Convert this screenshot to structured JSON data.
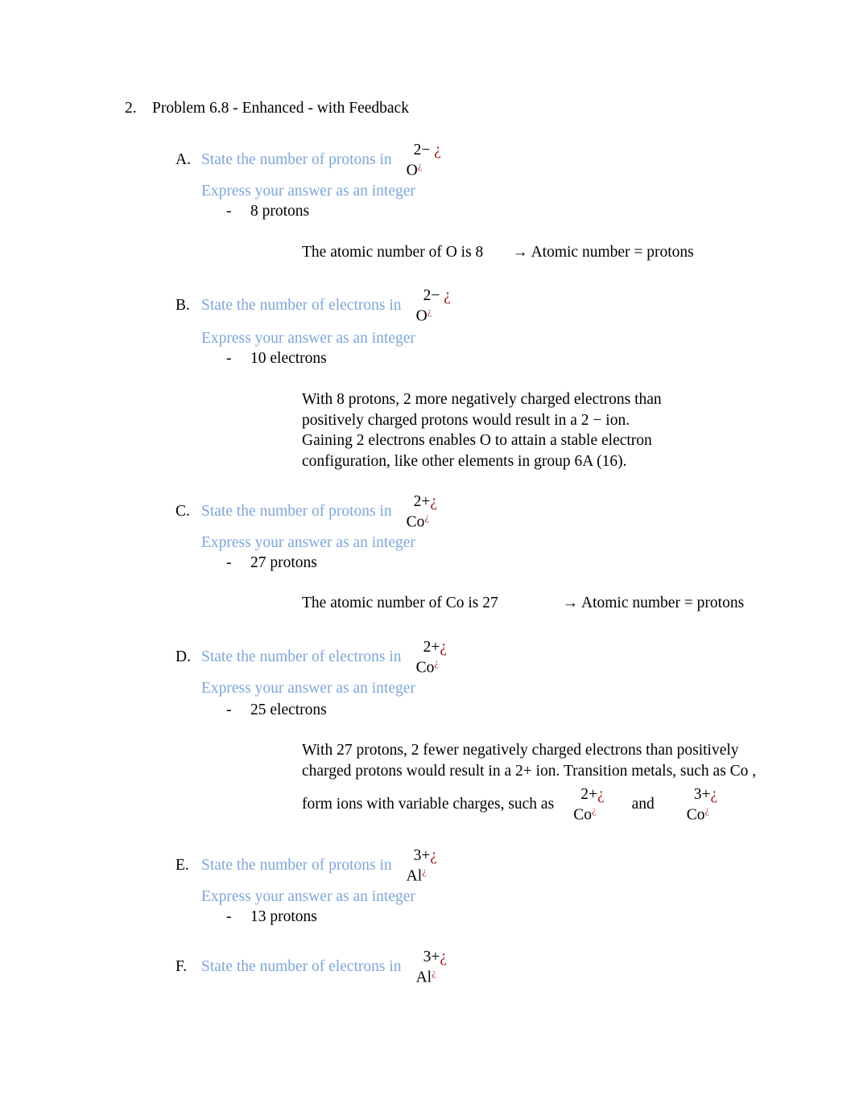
{
  "document": {
    "problem": {
      "number": "2.",
      "title": "Problem 6.8 - Enhanced - with Feedback"
    },
    "express_label": "Express your answer as an integer",
    "arrow_note": "→ Atomic number = protons",
    "and_word": "and",
    "parts": [
      {
        "letter": "A.",
        "question": "State the number of protons in",
        "formula": {
          "charge": "2−",
          "symbol": "O",
          "marker": "¿"
        },
        "express": "Express your answer as an integer",
        "answer_dash": "-",
        "answer": "8 protons",
        "explanation_type": "atomic-number",
        "explanation": "The atomic number of O is 8",
        "explanation_note": "→ Atomic number = protons"
      },
      {
        "letter": "B.",
        "question": "State the number of electrons in",
        "formula": {
          "charge": "2−",
          "symbol": "O",
          "marker": "¿"
        },
        "express": "Express your answer as an integer",
        "answer_dash": "-",
        "answer": "10 electrons",
        "explanation_type": "paragraph",
        "paragraph_lines": [
          "With 8 protons, 2 more negatively charged electrons than",
          "positively charged protons would result in a 2 − ion.",
          "Gaining 2 electrons enables O to attain a stable electron",
          "configuration, like other elements in group 6A (16)."
        ]
      },
      {
        "letter": "C.",
        "question": "State the number of protons in",
        "formula": {
          "charge": "2+",
          "symbol": "Co",
          "marker": "¿"
        },
        "express": "Express your answer as an integer",
        "answer_dash": "-",
        "answer": "27 protons",
        "explanation_type": "atomic-number",
        "explanation": "The atomic number of Co is 27",
        "explanation_note": "→ Atomic number = protons"
      },
      {
        "letter": "D.",
        "question": "State the number of electrons in",
        "formula": {
          "charge": "2+",
          "symbol": "Co",
          "marker": "¿"
        },
        "express": "Express your answer as an integer",
        "answer_dash": "-",
        "answer": "25 electrons",
        "explanation_type": "paragraph-with-formulas",
        "paragraph_lines": [
          "With 27 protons, 2 fewer negatively charged electrons than positively",
          "charged protons would result in a 2+ ion. Transition metals, such as Co ,"
        ],
        "trailing_text": "form ions with variable charges, such as",
        "trailing_formula_1": {
          "charge": "2+",
          "symbol": "Co",
          "marker": "¿"
        },
        "trailing_conjunction": "and",
        "trailing_formula_2": {
          "charge": "3+",
          "symbol": "Co",
          "marker": "¿"
        }
      },
      {
        "letter": "E.",
        "question": "State the number of protons in",
        "formula": {
          "charge": "3+",
          "symbol": "Al",
          "marker": "¿"
        },
        "express": "Express your answer as an integer",
        "answer_dash": "-",
        "answer": "13 protons",
        "explanation_type": "none"
      },
      {
        "letter": "F.",
        "question": "State the number of electrons in",
        "formula": {
          "charge": "3+",
          "symbol": "Al",
          "marker": "¿"
        },
        "explanation_type": "none"
      }
    ],
    "colors": {
      "question_blue": "#7DA7D9",
      "formula_red": "#9E1B1B",
      "body_black": "#000000",
      "page_background": "#FFFFFF"
    }
  }
}
